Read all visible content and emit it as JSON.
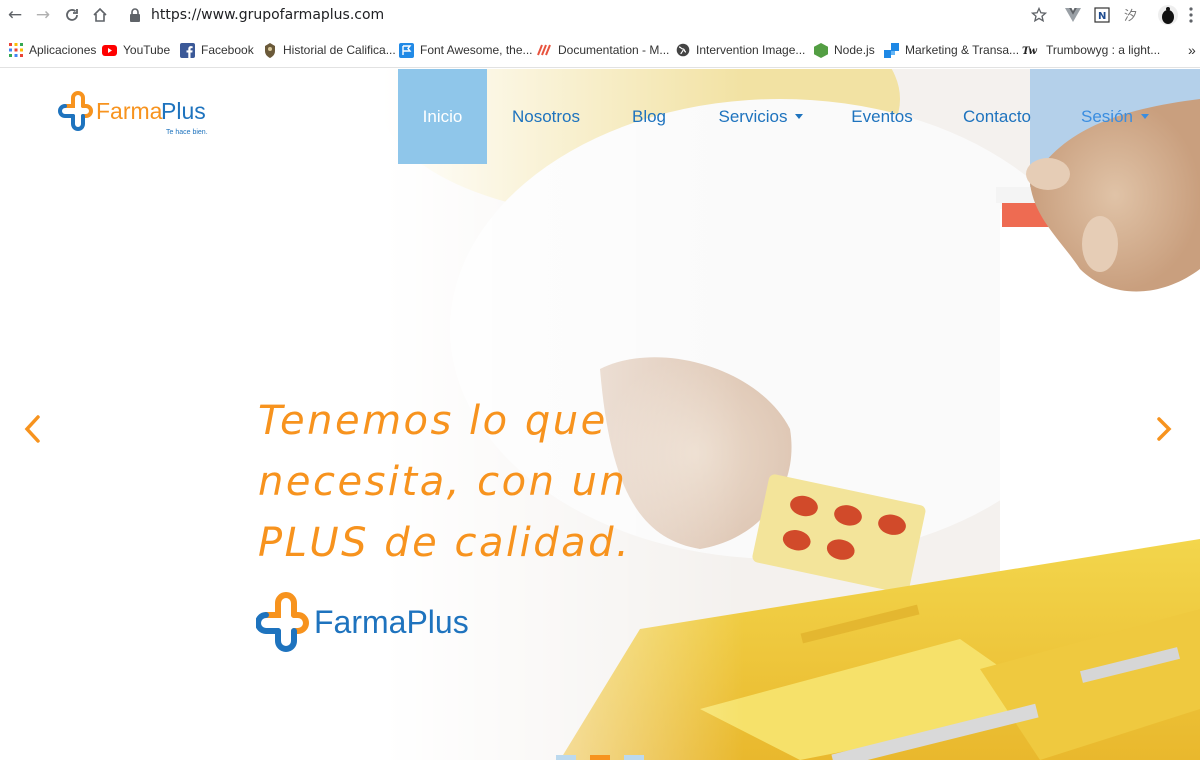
{
  "browser": {
    "url": "https://www.grupofarmaplus.com",
    "bookmarks": [
      {
        "label": "Aplicaciones",
        "icon": "apps-grid-icon"
      },
      {
        "label": "YouTube",
        "icon": "youtube-icon"
      },
      {
        "label": "Facebook",
        "icon": "facebook-icon"
      },
      {
        "label": "Historial de Califica...",
        "icon": "crest-icon"
      },
      {
        "label": "Font Awesome, the...",
        "icon": "flag-icon"
      },
      {
        "label": "Documentation - M...",
        "icon": "docs-icon"
      },
      {
        "label": "Intervention Image...",
        "icon": "globe-icon"
      },
      {
        "label": "Node.js",
        "icon": "nodejs-icon"
      },
      {
        "label": "Marketing & Transa...",
        "icon": "blocks-icon"
      },
      {
        "label": "Trumbowyg : a light...",
        "icon": "trumbowyg-icon"
      }
    ],
    "more_bookmarks": "»"
  },
  "site": {
    "brand": "FarmaPlus",
    "tagline": "Te hace bien.",
    "nav": [
      {
        "label": "Inicio",
        "active": true
      },
      {
        "label": "Nosotros"
      },
      {
        "label": "Blog"
      },
      {
        "label": "Servicios",
        "dropdown": true
      },
      {
        "label": "Eventos"
      },
      {
        "label": "Contacto"
      },
      {
        "label": "Sesión",
        "dropdown": true
      }
    ],
    "hero": {
      "lines": [
        "Tenemos lo que",
        "necesita, con un",
        "PLUS de calidad."
      ],
      "brand": "FarmaPlus"
    },
    "slides": {
      "count": 3,
      "active": 2
    }
  },
  "colors": {
    "orange": "#f7931e",
    "blue": "#1e73be",
    "active_nav_bg": "#8fc6ea"
  }
}
